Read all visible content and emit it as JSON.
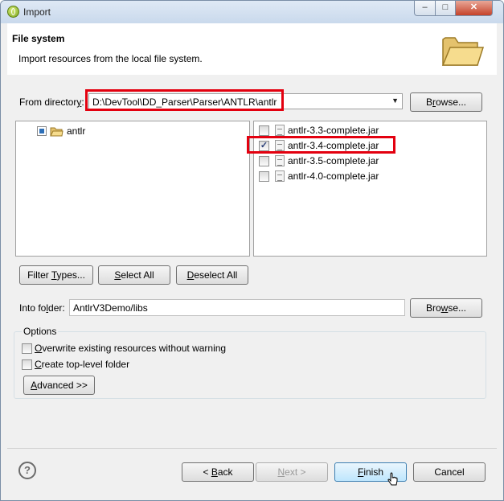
{
  "window": {
    "title": "Import"
  },
  "header": {
    "title": "File system",
    "description": "Import resources from the local file system."
  },
  "from_directory": {
    "label_pre": "From director",
    "label_mnemonic": "y",
    "label_post": ":",
    "value": "D:\\DevTool\\DD_Parser\\Parser\\ANTLR\\antlr",
    "browse_pre": "B",
    "browse_mnemonic": "r",
    "browse_post": "owse..."
  },
  "tree": {
    "items": [
      {
        "label": "antlr",
        "checked": "partial"
      }
    ]
  },
  "files": [
    {
      "label": "antlr-3.3-complete.jar",
      "checked": false
    },
    {
      "label": "antlr-3.4-complete.jar",
      "checked": true
    },
    {
      "label": "antlr-3.5-complete.jar",
      "checked": false
    },
    {
      "label": "antlr-4.0-complete.jar",
      "checked": false
    }
  ],
  "selection_buttons": {
    "filter_pre": "Filter ",
    "filter_mnemonic": "T",
    "filter_post": "ypes...",
    "select_all_mnemonic": "S",
    "select_all_post": "elect All",
    "deselect_all_mnemonic": "D",
    "deselect_all_post": "eselect All"
  },
  "into_folder": {
    "label_pre": "Into fo",
    "label_mnemonic": "l",
    "label_post": "der:",
    "value": "AntlrV3Demo/libs",
    "browse_pre": "Bro",
    "browse_mnemonic": "w",
    "browse_post": "se..."
  },
  "options": {
    "title": "Options",
    "overwrite_mnemonic": "O",
    "overwrite_post": "verwrite existing resources without warning",
    "toplevel_mnemonic": "C",
    "toplevel_post": "reate top-level folder",
    "advanced_mnemonic": "A",
    "advanced_post": "dvanced >>"
  },
  "footer": {
    "back_pre": "< ",
    "back_mnemonic": "B",
    "back_post": "ack",
    "next_mnemonic": "N",
    "next_post": "ext >",
    "finish_mnemonic": "F",
    "finish_post": "inish",
    "cancel": "Cancel",
    "help_icon": "?"
  },
  "colors": {
    "highlight": "#e3000f",
    "accent": "#3c7fb1"
  }
}
